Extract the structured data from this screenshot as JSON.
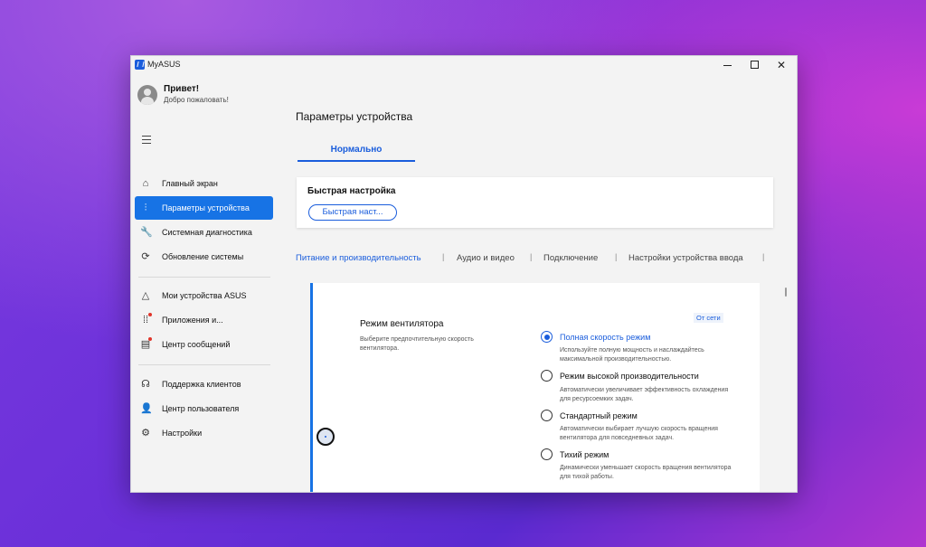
{
  "window": {
    "title": "MyASUS",
    "minimize": "",
    "maximize": "",
    "close": "✕"
  },
  "user": {
    "greeting": "Привет!",
    "welcome": "Добро пожаловать!"
  },
  "sidebar": {
    "items": [
      {
        "label": "Главный экран",
        "icon": "home-icon"
      },
      {
        "label": "Параметры устройства",
        "icon": "sliders-icon",
        "active": true
      },
      {
        "label": "Системная диагностика",
        "icon": "wrench-icon"
      },
      {
        "label": "Обновление системы",
        "icon": "update-icon"
      },
      {
        "label": "Мои устройства ASUS",
        "icon": "devices-icon"
      },
      {
        "label": "Приложения и...",
        "icon": "apps-grid-icon"
      },
      {
        "label": "Центр сообщений",
        "icon": "message-icon"
      },
      {
        "label": "Поддержка клиентов",
        "icon": "headset-icon"
      },
      {
        "label": "Центр пользователя",
        "icon": "user-icon"
      },
      {
        "label": "Настройки",
        "icon": "gear-icon"
      }
    ]
  },
  "main": {
    "title": "Параметры устройства",
    "mode_tab": "Нормально",
    "quick": {
      "title": "Быстрая настройка",
      "button": "Быстрая наст..."
    },
    "categories": [
      "Питание и производительность",
      "Аудио и видео",
      "Подключение",
      "Настройки устройства ввода"
    ],
    "fan": {
      "title": "Режим вентилятора",
      "description": "Выберите предпочтительную скорость вентилятора.",
      "badge": "От сети",
      "options": [
        {
          "label": "Полная скорость режим",
          "desc": "Используйте полную мощность и наслаждайтесь максимальной производительностью.",
          "selected": true
        },
        {
          "label": "Режим высокой производительности",
          "desc": "Автоматически увеличивает эффективность охлаждения для ресурсоемких задач."
        },
        {
          "label": "Стандартный режим",
          "desc": "Автоматически выбирает лучшую скорость вращения вентилятора для повседневных задач."
        },
        {
          "label": "Тихий режим",
          "desc": "Динамически уменьшает скорость вращения вентилятора для тихой работы."
        }
      ]
    }
  }
}
